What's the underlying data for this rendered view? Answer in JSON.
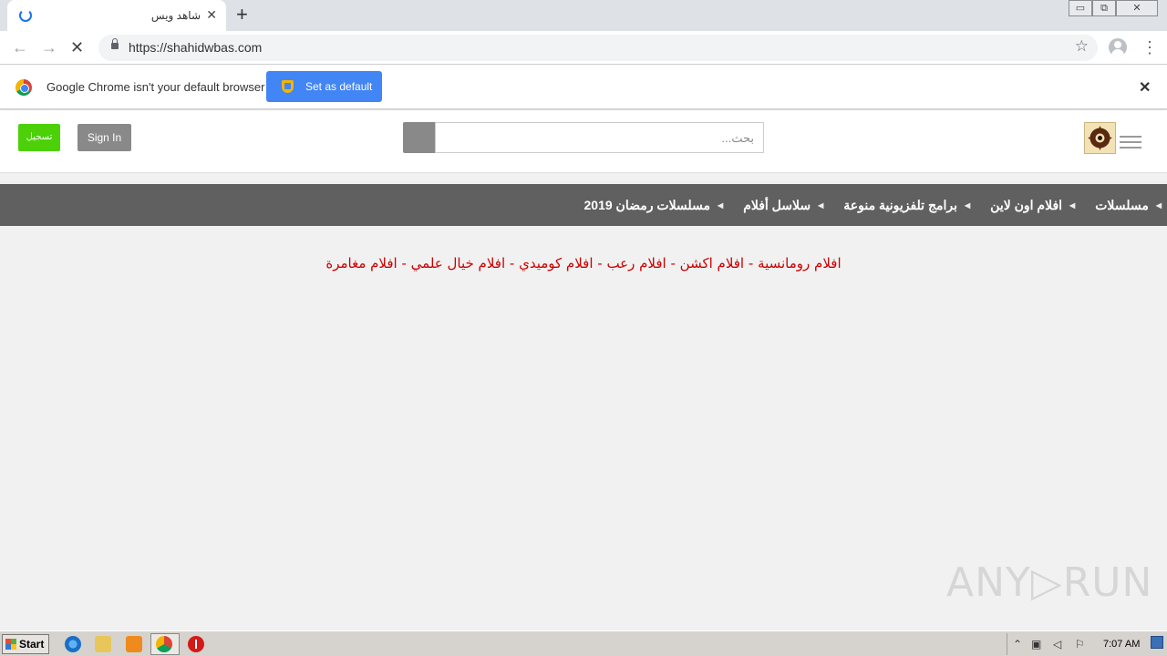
{
  "browser": {
    "tab_title": "شاهد ويس",
    "tab_close": "✕",
    "new_tab": "+",
    "url": "https://shahidwbas.com",
    "window_controls": [
      "▭",
      "⧉",
      "✕"
    ]
  },
  "infobar": {
    "message": "Google Chrome isn't your default browser",
    "button_label": "Set as default",
    "close": "✕"
  },
  "site": {
    "register_label": "تسجيل",
    "signin_label": "Sign In",
    "search_placeholder": "بحث...",
    "nav_items": [
      "مسلسلات",
      "افلام اون لاين",
      "برامج تلفزيونية منوعة",
      "سلاسل أفلام",
      "مسلسلات رمضان 2019"
    ],
    "genres": "افلام رومانسية - افلام اكشن - افلام رعب - افلام كوميدي - افلام خيال علمي - افلام مغامرة"
  },
  "watermark": {
    "text": "ANY▷RUN"
  },
  "taskbar": {
    "start_label": "Start",
    "clock": "7:07 AM"
  },
  "colors": {
    "register": "#4cd108",
    "signin": "#898989",
    "navbar": "#606060",
    "genre_text": "#cc0000",
    "infobar_button": "#4285f4"
  }
}
